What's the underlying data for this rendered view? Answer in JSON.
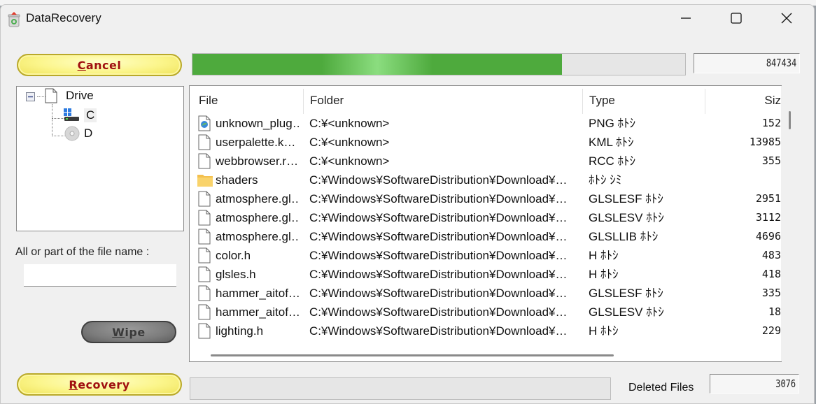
{
  "window": {
    "title": "DataRecovery",
    "controls": {
      "minimize": "minimize",
      "maximize": "maximize",
      "close": "close"
    }
  },
  "toolbar": {
    "cancel_label_accel": "C",
    "cancel_label_rest": "ancel",
    "scan_progress": 0.75,
    "scanned_count": "847434"
  },
  "drive_tree": {
    "root_label": "Drive",
    "root_icon": "document-icon",
    "expanded": true,
    "drives": [
      {
        "label": "C",
        "icon": "windows-drive-icon",
        "selected": true
      },
      {
        "label": "D",
        "icon": "cd-drive-icon",
        "selected": false
      }
    ]
  },
  "filter": {
    "label": "All or part of the file name :",
    "value": "",
    "placeholder": ""
  },
  "wipe_button": {
    "accel": "W",
    "rest": "ipe",
    "enabled": false
  },
  "recovery_button": {
    "accel": "R",
    "rest": "ecovery"
  },
  "file_list": {
    "columns": [
      "File",
      "Folder",
      "Type",
      "Siz"
    ],
    "rows": [
      {
        "icon": "image-file-icon",
        "file": "unknown_plug…",
        "folder": "C:¥<unknown>",
        "type": "PNG ﾎﾄｼ",
        "size": "152"
      },
      {
        "icon": "file-icon",
        "file": "userpalette.k…",
        "folder": "C:¥<unknown>",
        "type": "KML ﾎﾄｼ",
        "size": "13985"
      },
      {
        "icon": "file-icon",
        "file": "webbrowser.r…",
        "folder": "C:¥<unknown>",
        "type": "RCC ﾎﾄｼ",
        "size": "355"
      },
      {
        "icon": "folder-icon",
        "file": "shaders",
        "folder": "C:¥Windows¥SoftwareDistribution¥Download¥…",
        "type": "ﾎﾄｼ ｼﾐ",
        "size": ""
      },
      {
        "icon": "file-icon",
        "file": "atmosphere.gl…",
        "folder": "C:¥Windows¥SoftwareDistribution¥Download¥…",
        "type": "GLSLESF ﾎﾄｼ",
        "size": "2951"
      },
      {
        "icon": "file-icon",
        "file": "atmosphere.gl…",
        "folder": "C:¥Windows¥SoftwareDistribution¥Download¥…",
        "type": "GLSLESV ﾎﾄｼ",
        "size": "3112"
      },
      {
        "icon": "file-icon",
        "file": "atmosphere.gl…",
        "folder": "C:¥Windows¥SoftwareDistribution¥Download¥…",
        "type": "GLSLLIB ﾎﾄｼ",
        "size": "4696"
      },
      {
        "icon": "file-icon",
        "file": "color.h",
        "folder": "C:¥Windows¥SoftwareDistribution¥Download¥…",
        "type": "H ﾎﾄｼ",
        "size": "483"
      },
      {
        "icon": "file-icon",
        "file": "glsles.h",
        "folder": "C:¥Windows¥SoftwareDistribution¥Download¥…",
        "type": "H ﾎﾄｼ",
        "size": "418"
      },
      {
        "icon": "file-icon",
        "file": "hammer_aitof…",
        "folder": "C:¥Windows¥SoftwareDistribution¥Download¥…",
        "type": "GLSLESF ﾎﾄｼ",
        "size": "335"
      },
      {
        "icon": "file-icon",
        "file": "hammer_aitof…",
        "folder": "C:¥Windows¥SoftwareDistribution¥Download¥…",
        "type": "GLSLESV ﾎﾄｼ",
        "size": "18"
      },
      {
        "icon": "file-icon",
        "file": "lighting.h",
        "folder": "C:¥Windows¥SoftwareDistribution¥Download¥…",
        "type": "H ﾎﾄｼ",
        "size": "229"
      }
    ]
  },
  "status": {
    "recovery_progress": 0,
    "deleted_files_label": "Deleted Files",
    "deleted_files_count": "3076"
  },
  "colors": {
    "progress_green": "#4eaa3d",
    "button_yellow": "#fbf58a",
    "button_text_red": "#a01010",
    "button_disabled_gray": "#7c7c7c"
  }
}
